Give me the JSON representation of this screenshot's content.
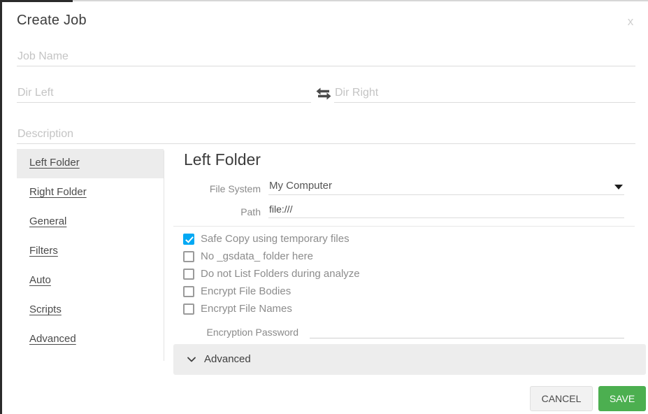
{
  "window": {
    "title": "Create Job",
    "close_label": "x"
  },
  "form": {
    "job_name_placeholder": "Job Name",
    "job_name_value": "",
    "dir_left_placeholder": "Dir Left",
    "dir_left_value": "",
    "dir_right_placeholder": "Dir Right",
    "dir_right_value": "",
    "description_placeholder": "Description",
    "description_value": "",
    "swap_icon": "swap-horizontal-icon"
  },
  "sidebar": {
    "items": [
      {
        "label": "Left Folder",
        "active": true
      },
      {
        "label": "Right Folder",
        "active": false
      },
      {
        "label": "General",
        "active": false
      },
      {
        "label": "Filters",
        "active": false
      },
      {
        "label": "Auto",
        "active": false
      },
      {
        "label": "Scripts",
        "active": false
      },
      {
        "label": "Advanced",
        "active": false
      }
    ]
  },
  "panel": {
    "title": "Left Folder",
    "file_system": {
      "label": "File System",
      "value": "My Computer",
      "caret_icon": "chevron-down-icon"
    },
    "path": {
      "label": "Path",
      "value": "file:///"
    },
    "checkboxes": [
      {
        "label": "Safe Copy using temporary files",
        "checked": true
      },
      {
        "label": "No _gsdata_ folder here",
        "checked": false
      },
      {
        "label": "Do not List Folders during analyze",
        "checked": false
      },
      {
        "label": "Encrypt File Bodies",
        "checked": false
      },
      {
        "label": "Encrypt File Names",
        "checked": false
      }
    ],
    "encryption_password": {
      "label": "Encryption Password",
      "value": "",
      "placeholder": ""
    },
    "advanced": {
      "label": "Advanced",
      "chevron_icon": "chevron-down-icon",
      "expanded": false
    }
  },
  "footer": {
    "cancel_label": "CANCEL",
    "save_label": "SAVE"
  },
  "colors": {
    "accent_checkbox": "#03a9f4",
    "save_button": "#4caf50",
    "sidebar_active": "#ececec",
    "advanced_panel": "#ededed"
  }
}
